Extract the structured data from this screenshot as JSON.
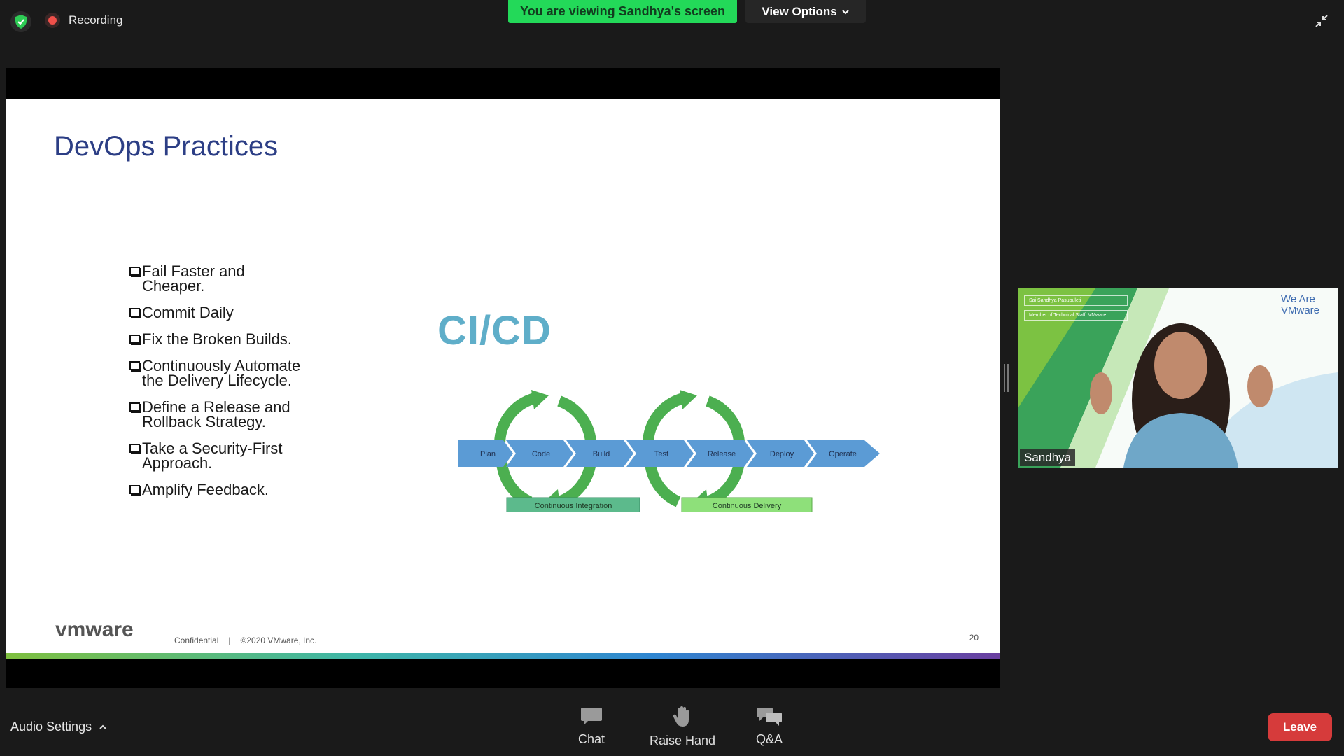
{
  "top_bar": {
    "recording_label": "Recording",
    "banner_text": "You are viewing Sandhya's screen",
    "view_options_label": "View Options"
  },
  "slide": {
    "title": "DevOps Practices",
    "bullets": [
      "Fail Faster and Cheaper.",
      "Commit Daily",
      "Fix the Broken Builds.",
      "Continuously Automate the Delivery Lifecycle.",
      "Define a Release and Rollback Strategy.",
      "Take a Security-First Approach.",
      "Amplify Feedback."
    ],
    "diagram": {
      "title": "CI/CD",
      "stages": [
        "Plan",
        "Code",
        "Build",
        "Test",
        "Release",
        "Deploy",
        "Operate"
      ],
      "labels": [
        "Continuous Integration",
        "Continuous Delivery"
      ]
    },
    "footer": {
      "logo": "vmware",
      "confidential": "Confidential",
      "separator": "|",
      "copyright": "©2020 VMware, Inc.",
      "page_number": "20"
    }
  },
  "video": {
    "participant_name": "Sandhya",
    "overlay_name": "Sai Sandhya Pasupuleti",
    "overlay_title": "Member of Technical Staff, VMware",
    "brand_line1": "We Are",
    "brand_line2": "VMware"
  },
  "toolbar": {
    "audio_settings_label": "Audio Settings",
    "chat_label": "Chat",
    "raise_hand_label": "Raise Hand",
    "qa_label": "Q&A",
    "leave_label": "Leave"
  },
  "colors": {
    "banner_green": "#23d959",
    "leave_red": "#d63b3b",
    "slide_title_blue": "#2c3e85",
    "cicd_teal": "#5faec9",
    "stage_blue": "#5b9bd5",
    "cycle_green": "#4caf50"
  }
}
